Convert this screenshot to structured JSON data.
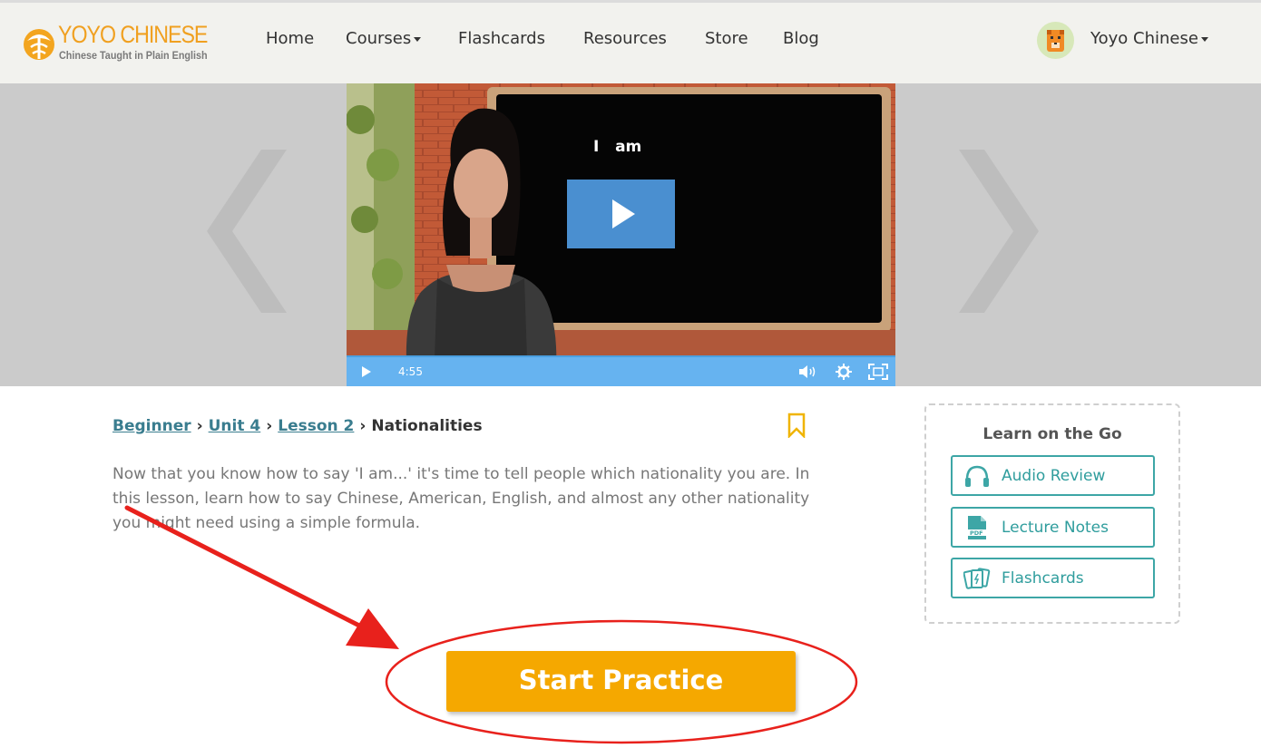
{
  "header": {
    "logo": {
      "title": "YOYO CHINESE",
      "subtitle": "Chinese Taught in Plain English"
    },
    "nav": [
      {
        "label": "Home",
        "has_dropdown": false
      },
      {
        "label": "Courses",
        "has_dropdown": true
      },
      {
        "label": "Flashcards",
        "has_dropdown": false
      },
      {
        "label": "Resources",
        "has_dropdown": false
      },
      {
        "label": "Store",
        "has_dropdown": false
      },
      {
        "label": "Blog",
        "has_dropdown": false
      }
    ],
    "user": {
      "name": "Yoyo Chinese",
      "has_dropdown": true,
      "avatar_icon": "tiger-avatar-icon"
    }
  },
  "video": {
    "caption": "I   am",
    "duration": "4:55",
    "icons": [
      "play-icon",
      "volume-icon",
      "settings-icon",
      "fullscreen-icon"
    ]
  },
  "lesson": {
    "breadcrumb": {
      "level": "Beginner",
      "unit": "Unit 4",
      "lesson": "Lesson 2",
      "title": "Nationalities",
      "separator": "›"
    },
    "description": "Now that you know how to say 'I am...' it's time to tell people which nationality you are. In this lesson, learn how to say Chinese, American, English, and almost any other nationality you might need using a simple formula."
  },
  "learn_on_the_go": {
    "title": "Learn on the Go",
    "buttons": [
      {
        "label": "Audio Review",
        "icon": "headphones-icon"
      },
      {
        "label": "Lecture Notes",
        "icon": "pdf-icon"
      },
      {
        "label": "Flashcards",
        "icon": "flashcards-icon"
      }
    ]
  },
  "actions": {
    "start_practice": "Start Practice"
  },
  "colors": {
    "brand_orange": "#f0a020",
    "teal": "#3da6a6",
    "link": "#3a7d8f",
    "practice_button": "#f5a800",
    "video_controls": "#66b3f0",
    "annotation_red": "#e8211c"
  }
}
